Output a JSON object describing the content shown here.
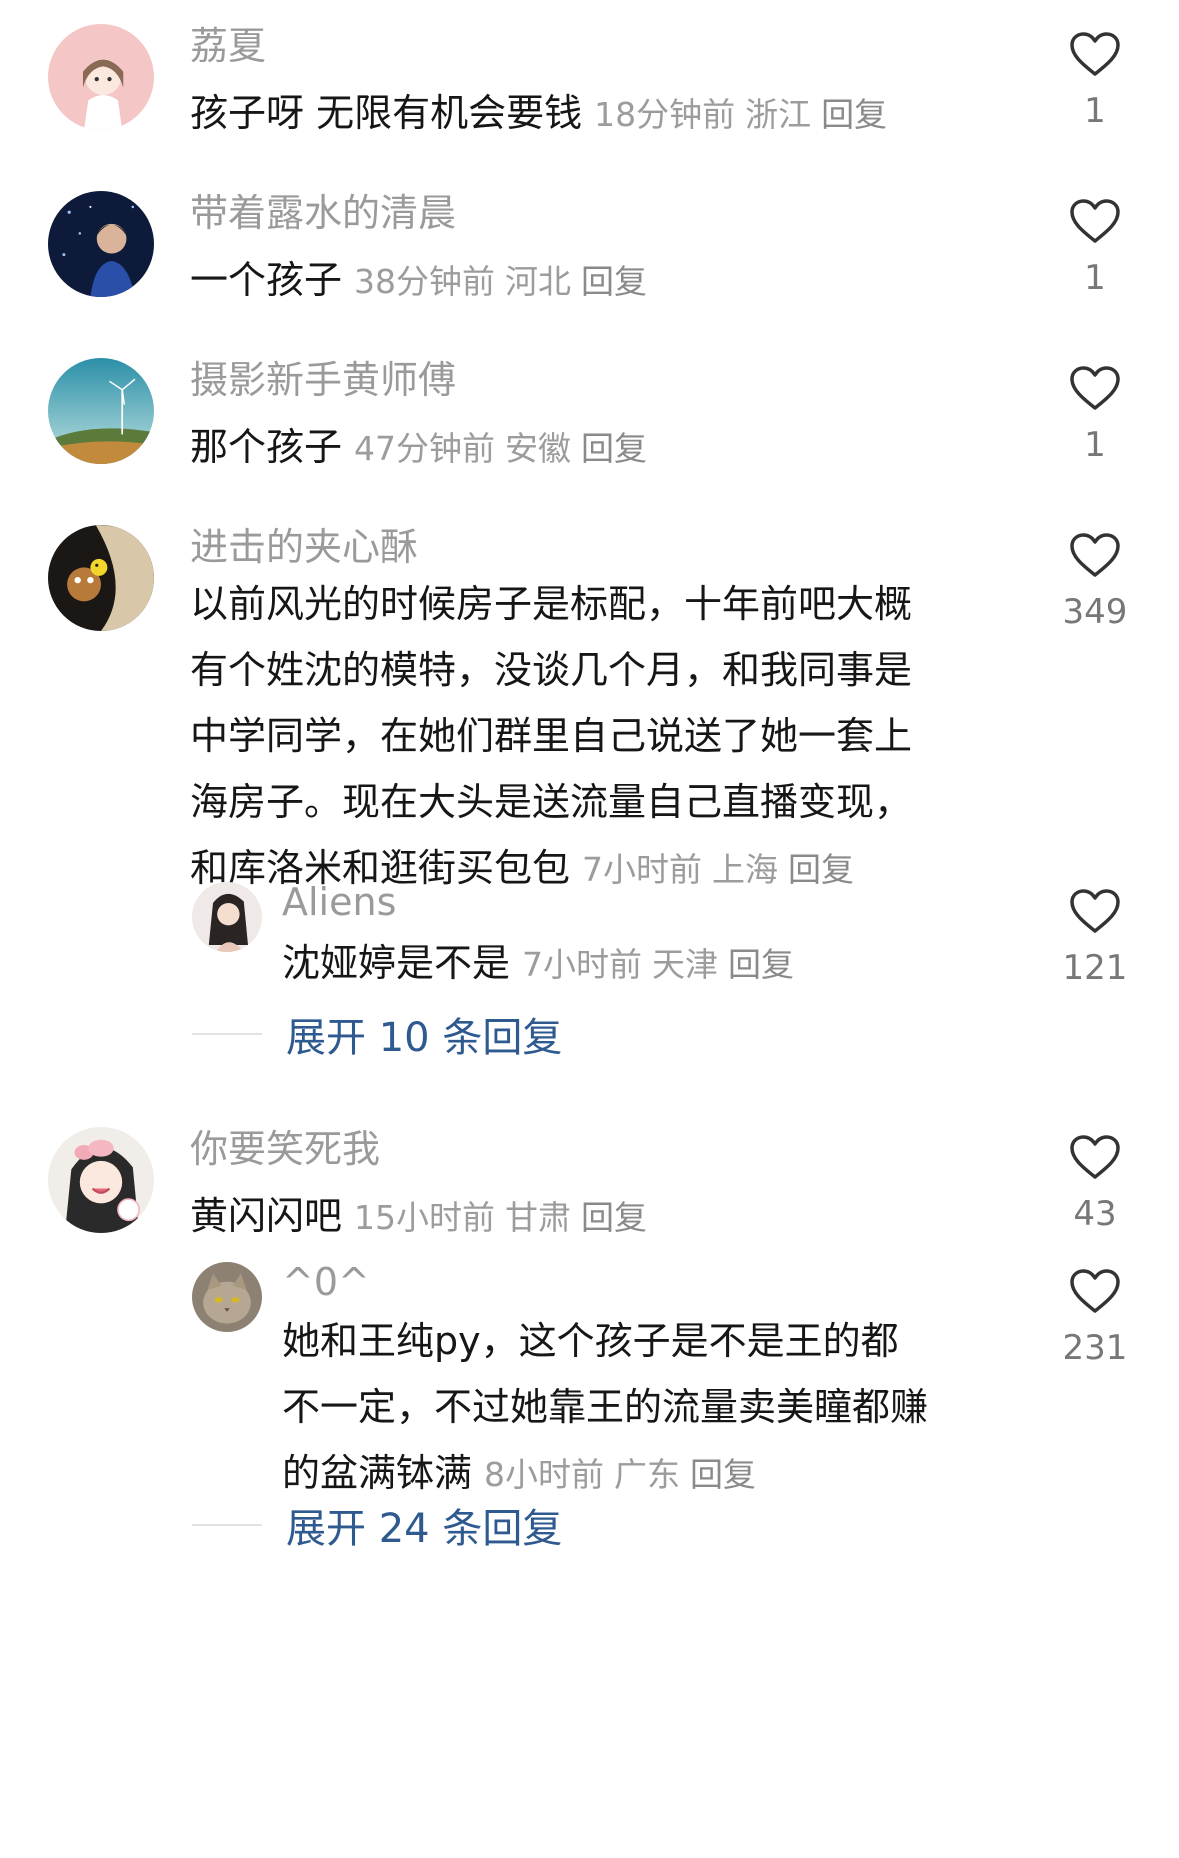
{
  "comments": [
    {
      "username": "荔夏",
      "text": "孩子呀 无限有机会要钱",
      "time": "18分钟前",
      "location": "浙江",
      "reply": "回复",
      "likes": "1"
    },
    {
      "username": "带着露水的清晨",
      "text": "一个孩子",
      "time": "38分钟前",
      "location": "河北",
      "reply": "回复",
      "likes": "1"
    },
    {
      "username": "摄影新手黄师傅",
      "text": "那个孩子",
      "time": "47分钟前",
      "location": "安徽",
      "reply": "回复",
      "likes": "1"
    },
    {
      "username": "进击的夹心酥",
      "text_lines": [
        "以前风光的时候房子是标配，十年前吧大概",
        "有个姓沈的模特，没谈几个月，和我同事是",
        "中学同学，在她们群里自己说送了她一套上",
        "海房子。现在大头是送流量自己直播变现，",
        "和库洛米和逛街买包包"
      ],
      "time": "7小时前",
      "location": "上海",
      "reply": "回复",
      "likes": "349",
      "sub_reply": {
        "username": "Aliens",
        "text": "沈娅婷是不是",
        "time": "7小时前",
        "location": "天津",
        "reply": "回复",
        "likes": "121"
      },
      "expand": "展开 10 条回复"
    },
    {
      "username": "你要笑死我",
      "text": "黄闪闪吧",
      "time": "15小时前",
      "location": "甘肃",
      "reply": "回复",
      "likes": "43",
      "sub_reply": {
        "username": "^0^",
        "text_lines": [
          "她和王纯py，这个孩子是不是王的都",
          "不一定，不过她靠王的流量卖美瞳都赚",
          "的盆满钵满"
        ],
        "time": "8小时前",
        "location": "广东",
        "reply": "回复",
        "likes": "231"
      },
      "expand": "展开 24 条回复"
    }
  ],
  "icons": {
    "like": "heart-outline-icon"
  },
  "colors": {
    "username": "#9a9a9a",
    "meta": "#9c9c9c",
    "expand_link": "#2f5a90",
    "heart_stroke": "#333333"
  }
}
